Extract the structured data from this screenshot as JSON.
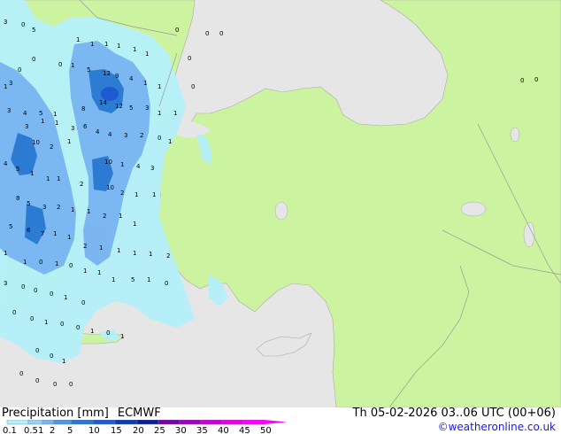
{
  "title": "Precipitation [mm]",
  "model": "ECMWF",
  "valid_time": "Th 05-02-2026 03..06 UTC (00+06)",
  "credit": "©weatheronline.co.uk",
  "legend": {
    "values": [
      "0.1",
      "0.5",
      "1",
      "2",
      "5",
      "10",
      "15",
      "20",
      "25",
      "30",
      "35",
      "40",
      "45",
      "50"
    ],
    "colors": [
      "#b4f0fa",
      "#96d2fa",
      "#78b4f0",
      "#5096e6",
      "#2878d2",
      "#1e5ad2",
      "#0a3cb4",
      "#0a1e96",
      "#7800aa",
      "#a000c8",
      "#c800dc",
      "#e600e6",
      "#ff00ff"
    ]
  },
  "colors": {
    "sea": "#e6e6e6",
    "land": "#ccf4a0",
    "precip_light": "#b4f0fa",
    "precip_mid": "#78b4f0",
    "precip_heavy": "#2878d2"
  },
  "map_values": [
    "3",
    "0",
    "5",
    "0",
    "0",
    "1",
    "1",
    "1",
    "1",
    "1",
    "1",
    "0",
    "0",
    "0",
    "0",
    "0",
    "0",
    "0",
    "1",
    "3",
    "1",
    "0",
    "1",
    "5",
    "12",
    "9",
    "4",
    "1",
    "1",
    "1",
    "3",
    "4",
    "5",
    "1",
    "8",
    "14",
    "12",
    "5",
    "3",
    "3",
    "1",
    "1",
    "3",
    "6",
    "4",
    "4",
    "3",
    "2",
    "0",
    "1",
    "10",
    "2",
    "1",
    "10",
    "1",
    "4",
    "3",
    "4",
    "5",
    "1",
    "1",
    "1",
    "2",
    "10",
    "2",
    "1",
    "1",
    "8",
    "5",
    "3",
    "2",
    "1",
    "1",
    "2",
    "1",
    "1",
    "5",
    "6",
    "7",
    "1",
    "1",
    "2",
    "1",
    "1",
    "1",
    "1",
    "2",
    "1",
    "1",
    "0",
    "1",
    "0",
    "1",
    "1",
    "1",
    "5",
    "1",
    "0",
    "3",
    "0",
    "0",
    "0",
    "1",
    "0",
    "0",
    "0",
    "1",
    "0",
    "0",
    "1",
    "0",
    "1",
    "0",
    "0",
    "1",
    "0",
    "0",
    "0",
    "0",
    "0",
    "0",
    "0",
    "0"
  ]
}
